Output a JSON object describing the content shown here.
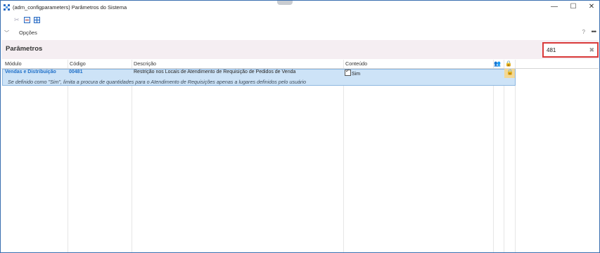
{
  "window": {
    "title": "(adm_configparameters)  Parâmetros do Sistema",
    "min_glyph": "—",
    "max_glyph": "☐",
    "close_glyph": "✕"
  },
  "toolbar": {
    "icons": [
      "scissors-icon",
      "calendar-icon",
      "grid-icon"
    ],
    "scissors_glyph": "✂"
  },
  "options": {
    "label": "Opções",
    "chevron": "﹀",
    "help": "?",
    "more": "•••"
  },
  "panel": {
    "title": "Parâmetros",
    "search_value": "481",
    "clear_glyph": "✖"
  },
  "table": {
    "headers": {
      "modulo": "Módulo",
      "codigo": "Código",
      "descricao": "Descrição",
      "conteudo": "Conteúdo",
      "user_glyph": "👥",
      "lock_glyph": "🔒"
    },
    "rows": [
      {
        "modulo": "Vendas e Distribuição",
        "codigo": "00481",
        "descricao": "Restrição nos Locais de Atendimento de Requisição de Pedidos de Venda",
        "conteudo": "Sim",
        "hint": "Se definido como \"Sim\", limita a procura de quantidades para o Atendimento de Requisições apenas a lugares definidos pelo usuário"
      }
    ]
  },
  "colors": {
    "accent": "#1e6fc8",
    "selection": "#cde3f7",
    "highlight_border": "#d93a3a",
    "band": "#f5eef2"
  }
}
